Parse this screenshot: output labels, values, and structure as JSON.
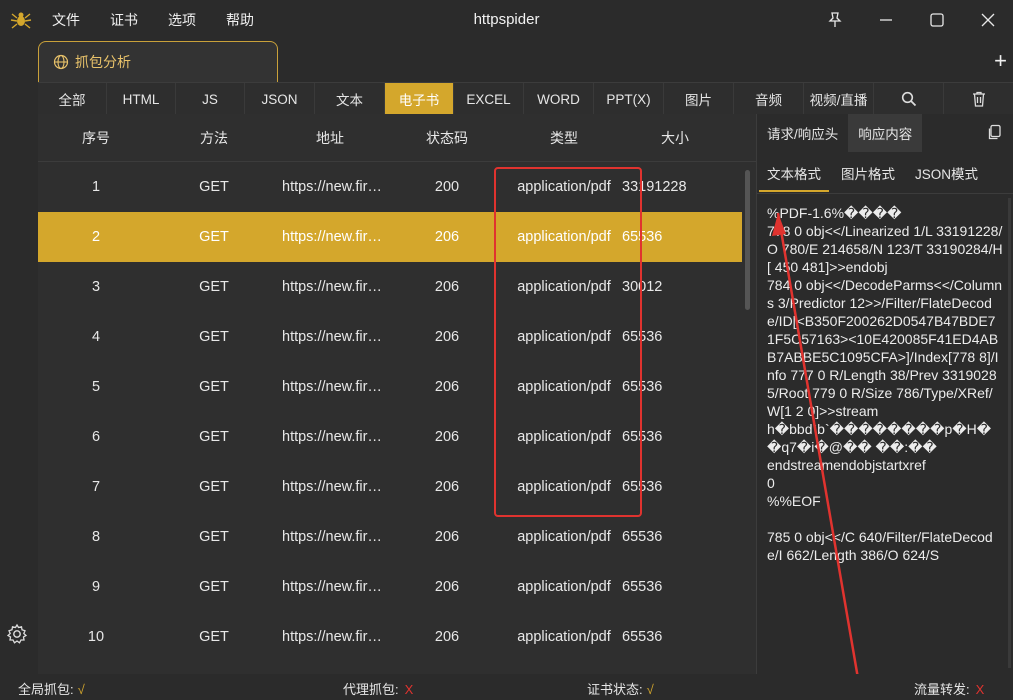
{
  "app": {
    "title": "httpspider"
  },
  "menu": [
    "文件",
    "证书",
    "选项",
    "帮助"
  ],
  "session_tab": {
    "label": "抓包分析"
  },
  "filters": {
    "items": [
      "全部",
      "HTML",
      "JS",
      "JSON",
      "文本",
      "电子书",
      "EXCEL",
      "WORD",
      "PPT(X)",
      "图片",
      "音频",
      "视频/直播"
    ],
    "active": "电子书"
  },
  "table": {
    "headers": [
      "序号",
      "方法",
      "地址",
      "状态码",
      "类型",
      "大小"
    ],
    "rows": [
      {
        "no": "1",
        "method": "GET",
        "url": "https://new.fir…",
        "status": "200",
        "type": "application/pdf",
        "size": "33191228"
      },
      {
        "no": "2",
        "method": "GET",
        "url": "https://new.fir…",
        "status": "206",
        "type": "application/pdf",
        "size": "65536"
      },
      {
        "no": "3",
        "method": "GET",
        "url": "https://new.fir…",
        "status": "206",
        "type": "application/pdf",
        "size": "30012"
      },
      {
        "no": "4",
        "method": "GET",
        "url": "https://new.fir…",
        "status": "206",
        "type": "application/pdf",
        "size": "65536"
      },
      {
        "no": "5",
        "method": "GET",
        "url": "https://new.fir…",
        "status": "206",
        "type": "application/pdf",
        "size": "65536"
      },
      {
        "no": "6",
        "method": "GET",
        "url": "https://new.fir…",
        "status": "206",
        "type": "application/pdf",
        "size": "65536"
      },
      {
        "no": "7",
        "method": "GET",
        "url": "https://new.fir…",
        "status": "206",
        "type": "application/pdf",
        "size": "65536"
      },
      {
        "no": "8",
        "method": "GET",
        "url": "https://new.fir…",
        "status": "206",
        "type": "application/pdf",
        "size": "65536"
      },
      {
        "no": "9",
        "method": "GET",
        "url": "https://new.fir…",
        "status": "206",
        "type": "application/pdf",
        "size": "65536"
      },
      {
        "no": "10",
        "method": "GET",
        "url": "https://new.fir…",
        "status": "206",
        "type": "application/pdf",
        "size": "65536"
      }
    ],
    "selected_row": "2"
  },
  "right_panel": {
    "tabs": [
      "请求/响应头",
      "响应内容"
    ],
    "active_tab": "响应内容",
    "subtabs": [
      "文本格式",
      "图片格式",
      "JSON模式"
    ],
    "active_subtab": "文本格式",
    "content": "%PDF-1.6%����\n778 0 obj<</Linearized 1/L 33191228/O 780/E 214658/N 123/T 33190284/H [ 450 481]>>endobj\n784 0 obj<</DecodeParms<</Columns 3/Predictor 12>>/Filter/FlateDecode/ID[<B350F200262D0547B47BDE71F5C57163><10E420085F41ED4ABB7ABBE5C1095CFA>]/Index[778 8]/Info 777 0 R/Length 38/Prev 33190285/Root 779 0 R/Size 786/Type/XRef/W[1 2 0]>>stream\nh�bbd`b`��������p�H�\n�q7�i�@�� ��:��\nendstreamendobjstartxref\n0\n%%EOF\n\n785 0 obj<</C 640/Filter/FlateDecode/I 662/Length 386/O 624/S"
  },
  "status": {
    "global_capture": {
      "label": "全局抓包:",
      "value": "√"
    },
    "proxy_capture": {
      "label": "代理抓包:",
      "value": "X"
    },
    "cert_status": {
      "label": "证书状态:",
      "value": "√"
    },
    "traffic_forward": {
      "label": "流量转发:",
      "value": "X"
    }
  },
  "colors": {
    "accent": "#d4a72c",
    "annotation": "#e0332f"
  }
}
